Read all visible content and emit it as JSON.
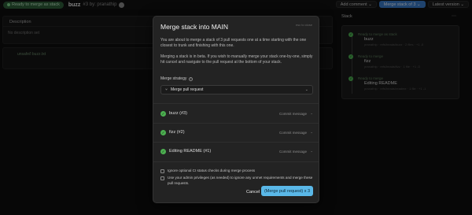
{
  "topbar": {
    "status": "Ready to merge as stack",
    "title": "buzz",
    "number_by": "#3 by: pranathip",
    "add_comment": "Add comment",
    "merge_stack": "Merge stack of 3",
    "latest_version": "Latest version"
  },
  "description": {
    "heading": "Description",
    "empty": "No description set"
  },
  "file": {
    "name": "unsafe/l buzz.txt"
  },
  "stack": {
    "title": "Stack",
    "items": [
      {
        "status": "Ready to merge as stack",
        "name": "buzz",
        "meta": "pranathip · refs/heads/buzz · 2 files · +1 -0"
      },
      {
        "status": "Ready to merge",
        "name": "fizz",
        "meta": "pranathip · refs/heads/fizz · 1 file · +1 -0"
      },
      {
        "status": "Ready to merge",
        "name": "Editing README",
        "meta": "pranathip · refs/heads/readme · 1 file · +1 -1"
      }
    ]
  },
  "modal": {
    "title": "Merge stack into MAIN",
    "close": "esc to close",
    "p1": "You are about to merge a stack of 3 pull requests one at a time starting with the one closest to trunk and finishing with this one.",
    "p2": "Merging a stack is in beta. If you wish to manually merge your stack one-by-one, simply hit cancel and navigate to the pull request at the bottom of your stack.",
    "strategy_label": "Merge strategy",
    "strategy_value": "Merge pull request",
    "prs": [
      {
        "name": "buzz (#3)",
        "commit": "Commit message"
      },
      {
        "name": "fizz (#2)",
        "commit": "Commit message"
      },
      {
        "name": "Editing README (#1)",
        "commit": "Commit message"
      }
    ],
    "option1": "Ignore optional CI status checks during merge process",
    "option2": "Use your admin privileges (as needed) to ignore any unmet requirements and merge these pull requests.",
    "cancel": "Cancel",
    "merge": "(Merge pull request) x 3"
  }
}
